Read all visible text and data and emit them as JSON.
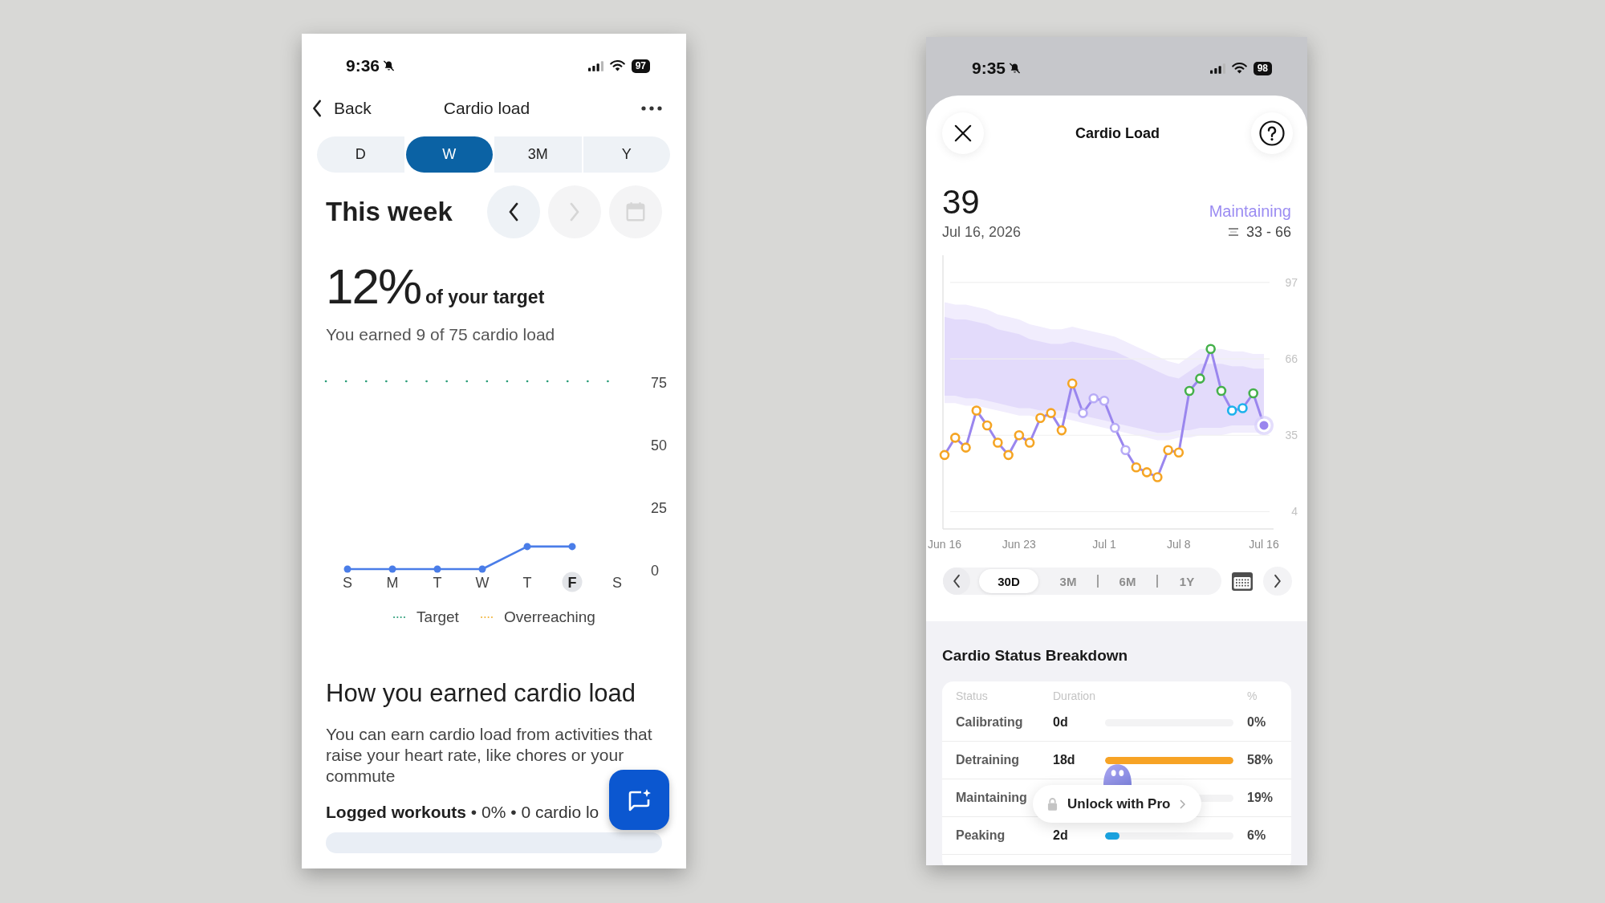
{
  "left_screen": {
    "status_bar": {
      "time": "9:36",
      "battery": "97"
    },
    "nav": {
      "back": "Back",
      "title": "Cardio load"
    },
    "tabs": [
      {
        "label": "D",
        "selected": false
      },
      {
        "label": "W",
        "selected": true
      },
      {
        "label": "3M",
        "selected": false
      },
      {
        "label": "Y",
        "selected": false
      }
    ],
    "period": {
      "title": "This week",
      "buttons": [
        {
          "kind": "previous",
          "disabled": false
        },
        {
          "kind": "next",
          "disabled": true
        },
        {
          "kind": "calendar",
          "disabled": true
        }
      ]
    },
    "summary": {
      "percent": "12%",
      "suffix": "of your target",
      "detail": "You earned 9 of 75 cardio load"
    },
    "chart": {
      "chart_data": {
        "type": "line",
        "categories": [
          "S",
          "M",
          "T",
          "W",
          "T",
          "F",
          "S"
        ],
        "series": [
          {
            "color": "#4a7de8",
            "marker": "circle",
            "values": [
              0,
              0,
              0,
              0,
              9,
              9,
              null
            ]
          }
        ],
        "ylim": [
          0,
          75
        ],
        "yticks": [
          0,
          25,
          50,
          75
        ],
        "ref_lines": [
          {
            "axis": "y",
            "value": 75,
            "color": "#2a9d78"
          }
        ]
      },
      "day_marks": [
        {
          "selected": false
        },
        {
          "selected": false
        },
        {
          "selected": false
        },
        {
          "selected": false
        },
        {
          "selected": false
        },
        {
          "selected": true
        },
        {
          "selected": false
        }
      ],
      "legend": [
        {
          "label": "Target",
          "color": "#2a9d78"
        },
        {
          "label": "Overreaching",
          "color": "#f2b53a"
        }
      ]
    },
    "earned": {
      "heading": "How you earned cardio load",
      "description": "You can earn cardio load from activities that raise your heart rate, like chores or your commute",
      "rows": [
        {
          "text": "**Logged workouts** • 0% • 0 cardio lo"
        }
      ]
    }
  },
  "right_screen": {
    "status_bar": {
      "time": "9:35",
      "battery": "98"
    },
    "header": {
      "title": "Cardio Load"
    },
    "current": {
      "value": "39",
      "date": "Jul 16, 2026",
      "status": "Maintaining",
      "range": "33 - 66"
    },
    "chart": {
      "chart_data": {
        "type": "line",
        "categories": [
          "Jun 16",
          null,
          null,
          null,
          null,
          null,
          null,
          "Jun 23",
          null,
          null,
          null,
          null,
          null,
          null,
          null,
          "Jul 1",
          null,
          null,
          null,
          null,
          null,
          null,
          "Jul 8",
          null,
          null,
          null,
          null,
          null,
          null,
          null,
          "Jul 16"
        ],
        "ylim": [
          -3,
          108
        ],
        "yticks": [
          4,
          35,
          66,
          97
        ],
        "grid": true,
        "series": [
          {
            "color": "#9a86ee",
            "marker": "circle",
            "values": [
              27,
              34,
              30,
              45,
              39,
              32,
              27,
              35,
              32,
              42,
              44,
              37,
              56,
              44,
              50,
              49,
              38,
              29,
              22,
              20,
              18,
              29,
              28,
              53,
              58,
              70,
              53,
              45,
              46,
              52,
              39
            ],
            "colors": [
              "#f5a524",
              "#f5a524",
              "#f5a524",
              "#f5a524",
              "#f5a524",
              "#f5a524",
              "#f5a524",
              "#f5a524",
              "#f5a524",
              "#f5a524",
              "#f5a524",
              "#f5a524",
              "#f5a524",
              "#b8acf6",
              "#b8acf6",
              "#b8acf6",
              "#b8acf6",
              "#b8acf6",
              "#f5a524",
              "#f5a524",
              "#f5a524",
              "#f5a524",
              "#f5a524",
              "#45b14b",
              "#45b14b",
              "#45b14b",
              "#45b14b",
              "#1db2ec",
              "#1db2ec",
              "#45b14b",
              "#9a86ee"
            ]
          }
        ]
      }
    },
    "ranges": [
      {
        "label": "30D",
        "selected": true
      },
      {
        "label": "3M",
        "selected": false
      },
      {
        "label": "6M",
        "selected": false
      },
      {
        "label": "1Y",
        "selected": false
      }
    ],
    "breakdown": {
      "title": "Cardio Status Breakdown",
      "columns": [
        "Status",
        "Duration",
        "%"
      ],
      "rows": [
        {
          "status": "Calibrating",
          "duration": "0d",
          "percent": "0%"
        },
        {
          "status": "Detraining",
          "duration": "18d",
          "level": 1,
          "percent": "58%",
          "color": "#f7a325"
        },
        {
          "status": "Maintaining",
          "percent": "19%"
        },
        {
          "status": "Peaking",
          "duration": "2d",
          "level": 0.11,
          "percent": "6%",
          "color": "#1aa3e0"
        }
      ]
    },
    "unlock": {
      "label": "Unlock with Pro"
    }
  }
}
